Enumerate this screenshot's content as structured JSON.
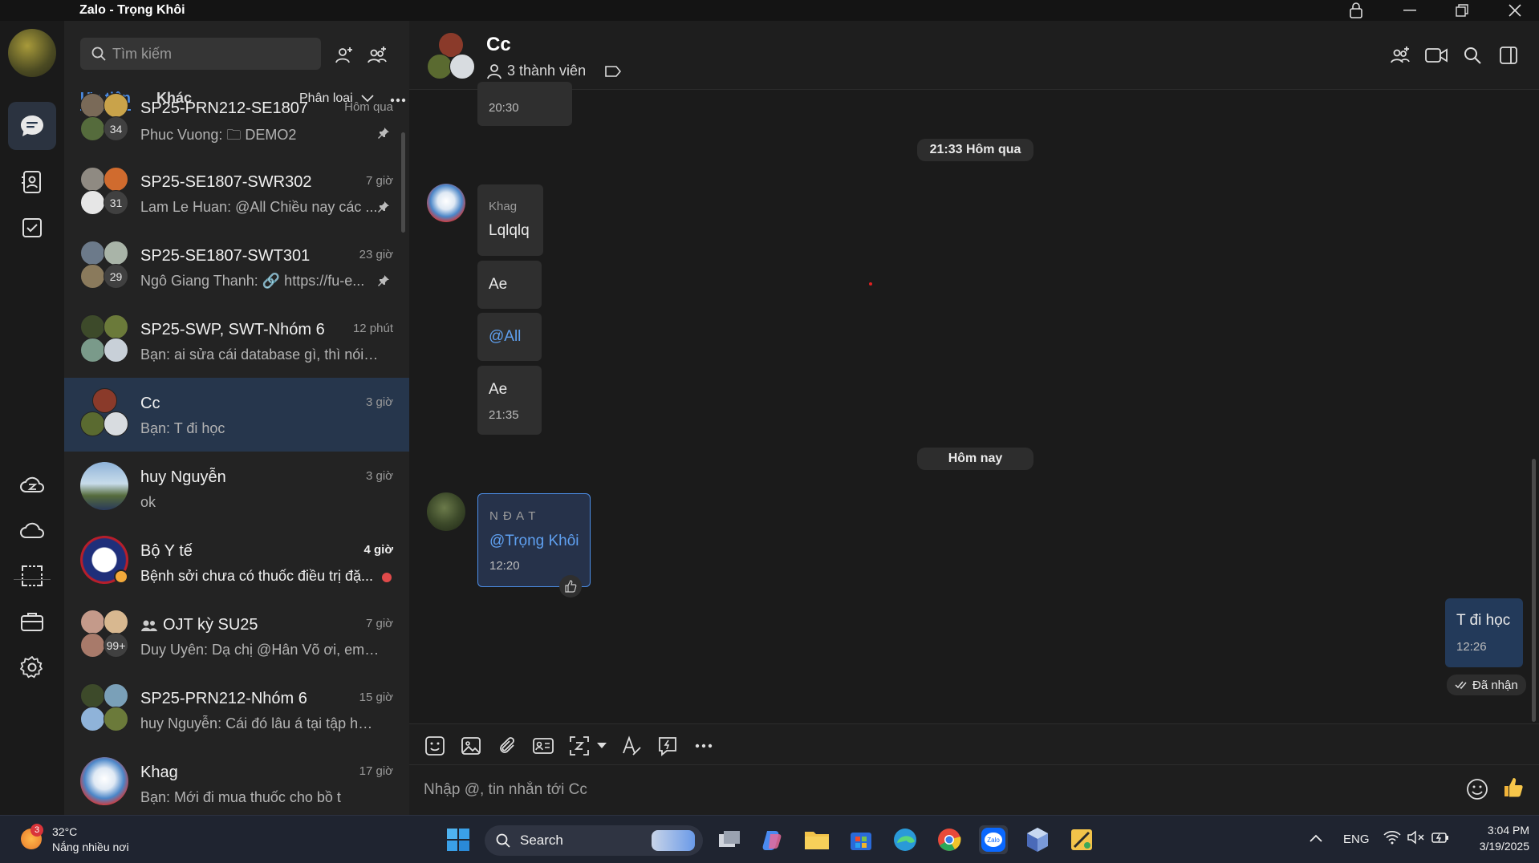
{
  "window": {
    "title": "Zalo - Trọng Khôi"
  },
  "sidebar": {
    "search_placeholder": "Tìm kiếm",
    "tabs": [
      {
        "label": "Ưu tiên",
        "active": true
      },
      {
        "label": "Khác",
        "active": false
      }
    ],
    "filter_label": "Phân loại",
    "conversations": [
      {
        "name": "SP25-PRN212-SE1807",
        "time": "Hôm qua",
        "preview": "Phuc Vuong: 🗀 DEMO2",
        "badge": "34",
        "pinned": true
      },
      {
        "name": "SP25-SE1807-SWR302",
        "time": "7 giờ",
        "preview": "Lam Le Huan: @All Chiều nay các ...",
        "badge": "31",
        "pinned": true
      },
      {
        "name": "SP25-SE1807-SWT301",
        "time": "23 giờ",
        "preview": "Ngô Giang Thanh: 🔗 https://fu-e...",
        "badge": "29",
        "pinned": true
      },
      {
        "name": "SP25-SWP, SWT-Nhóm 6",
        "time": "12 phút",
        "preview": "Bạn: ai sửa cái database gì, thì nói lên ..."
      },
      {
        "name": "Cc",
        "time": "3 giờ",
        "preview": "Bạn: T đi học",
        "selected": true
      },
      {
        "name": "huy Nguyễn",
        "time": "3 giờ",
        "preview": "ok"
      },
      {
        "name": "Bộ Y tế",
        "time": "4 giờ",
        "preview": "Bệnh sởi chưa có thuốc điều trị đặ...",
        "unread": true
      },
      {
        "name": "OJT kỳ SU25",
        "time": "7 giờ",
        "preview": "Duy Uyên: Dạ chị @Hân Võ ơi, em có ...",
        "badge": "99+"
      },
      {
        "name": "SP25-PRN212-Nhóm 6",
        "time": "15 giờ",
        "preview": "huy Nguyễn: Cái đó lâu á tại tập hợp ..."
      },
      {
        "name": "Khag",
        "time": "17 giờ",
        "preview": "Bạn: Mới đi mua thuốc cho bồ t"
      }
    ]
  },
  "chat": {
    "name": "Cc",
    "members": "3 thành viên",
    "messages": {
      "top_time": "20:30",
      "date1": "21:33 Hôm qua",
      "khag_sender": "Khag",
      "khag_msgs": [
        "Lqlqlq",
        "Ae",
        "@All",
        "Ae"
      ],
      "khag_last_time": "21:35",
      "date2": "Hôm nay",
      "ndat_sender": "N Đ A T",
      "ndat_text": "@Trọng Khôi",
      "ndat_time": "12:20",
      "my_text": "T đi học",
      "my_time": "12:26",
      "status": "Đã nhận"
    },
    "composer_placeholder": "Nhập @, tin nhắn tới Cc"
  },
  "taskbar": {
    "weather_temp": "32°C",
    "weather_desc": "Nắng nhiều nơi",
    "weather_badge": "3",
    "search_label": "Search",
    "lang": "ENG",
    "time": "3:04 PM",
    "date": "3/19/2025"
  },
  "colors": {
    "accent": "#4c8ee8",
    "selected_row": "#26364c",
    "my_bubble": "#233a5a",
    "unread_dot": "#e04a4a"
  }
}
